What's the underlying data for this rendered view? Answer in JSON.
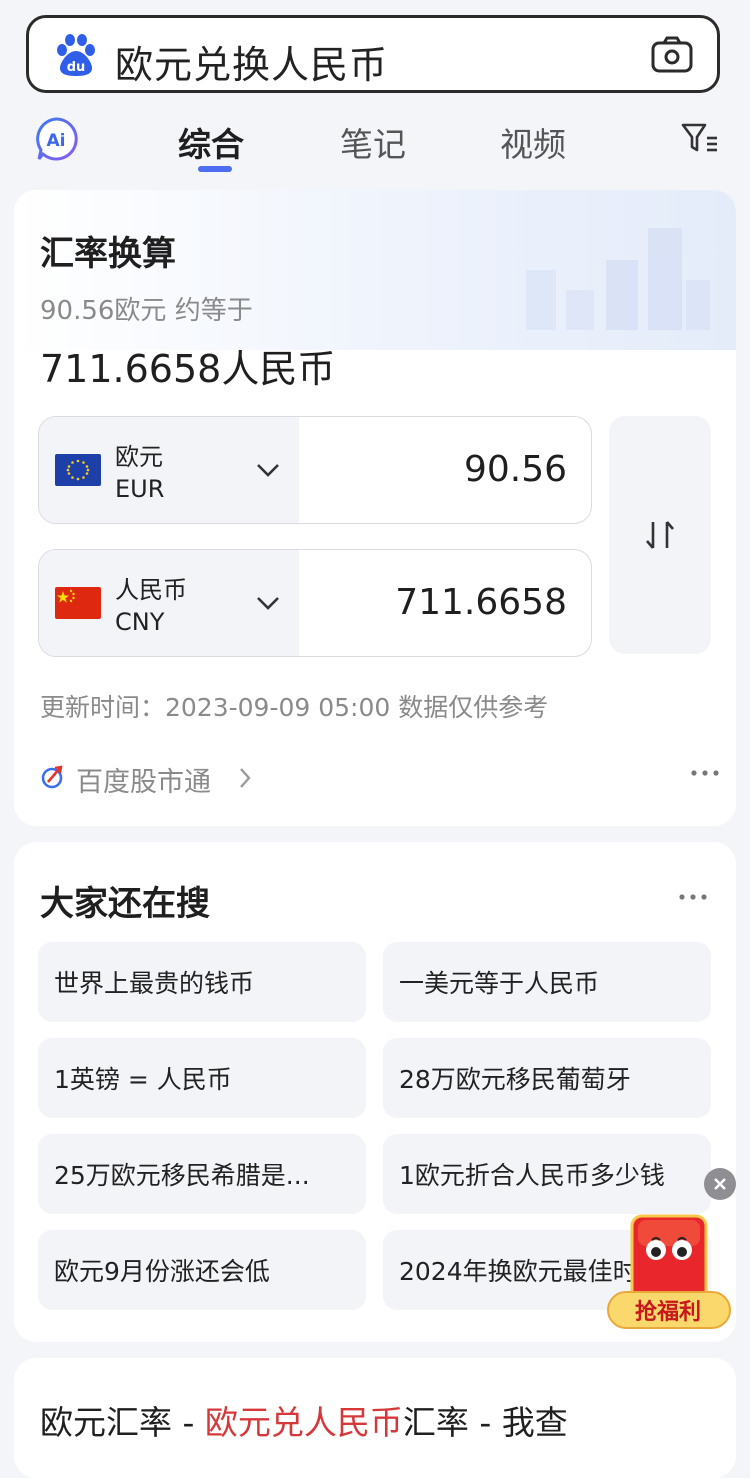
{
  "search": {
    "query": "欧元兑换人民币"
  },
  "tabs": [
    {
      "label": "综合",
      "active": true
    },
    {
      "label": "笔记",
      "active": false
    },
    {
      "label": "视频",
      "active": false
    }
  ],
  "converter": {
    "title": "汇率换算",
    "summary": "90.56欧元 约等于",
    "result": "711.6658人民币",
    "from": {
      "name": "欧元",
      "code": "EUR",
      "amount": "90.56"
    },
    "to": {
      "name": "人民币",
      "code": "CNY",
      "amount": "711.6658"
    },
    "update_time": "更新时间：2023-09-09 05:00 数据仅供参考",
    "source": "百度股市通"
  },
  "related": {
    "title": "大家还在搜",
    "items": [
      "世界上最贵的钱币",
      "一美元等于人民币",
      "1英镑 = 人民币",
      "28万欧元移民葡萄牙",
      "25万欧元移民希腊是...",
      "1欧元折合人民币多少钱",
      "欧元9月份涨还会低",
      "2024年换欧元最佳时"
    ]
  },
  "result_card": {
    "title_prefix": "欧元汇率 - ",
    "title_highlight": "欧元兑人民币",
    "title_suffix": "汇率 - 我查"
  },
  "promo": {
    "label": "抢福利"
  },
  "colors": {
    "accent": "#4e6ef2",
    "highlight": "#d6383a",
    "promo_red": "#e8262b"
  }
}
